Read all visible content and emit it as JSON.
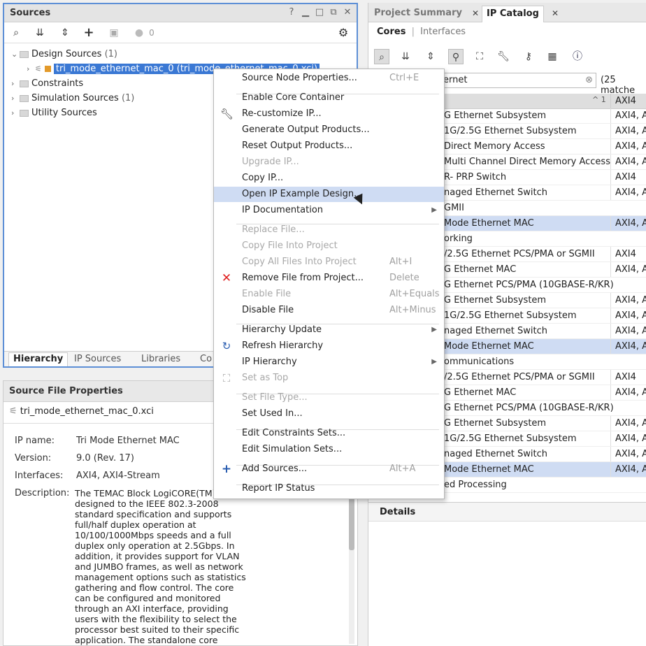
{
  "sources": {
    "title": "Sources",
    "badge_count": "0",
    "tree": [
      {
        "label": "Design Sources",
        "count": "(1)"
      },
      {
        "label": "tri_mode_ethernet_mac_0 (tri_mode_ethernet_mac_0.xci)"
      },
      {
        "label": "Constraints"
      },
      {
        "label": "Simulation Sources",
        "count": "(1)"
      },
      {
        "label": "Utility Sources"
      }
    ],
    "tabs": [
      "Hierarchy",
      "IP Sources",
      "Libraries",
      "Co"
    ]
  },
  "props": {
    "title": "Source File Properties",
    "filename": "tri_mode_ethernet_mac_0.xci",
    "ip_name_label": "IP name:",
    "ip_name": "Tri Mode Ethernet MAC",
    "version_label": "Version:",
    "version": "9.0 (Rev. 17)",
    "interfaces_label": "Interfaces:",
    "interfaces": "AXI4, AXI4-Stream",
    "description_label": "Description:",
    "description": "The TEMAC Block LogiCORE(TM)\ndesigned to the IEEE 802.3-2008\nstandard specification and supports\nfull/half duplex operation at\n10/100/1000Mbps speeds and a full\nduplex only operation at 2.5Gbps. In\naddition, it provides support for VLAN\nand JUMBO frames, as well as network\nmanagement options such as statistics\ngathering and flow control. The core\ncan be configured and monitored\nthrough an AXI interface, providing\nusers with the flexibility to select the\nprocessor best suited to their specific\napplication. The standalone core"
  },
  "right": {
    "tabs": [
      "Project Summary",
      "IP Catalog"
    ],
    "subtabs": [
      "Cores",
      "Interfaces"
    ],
    "search_value": "ernet",
    "matches": "(25 matche",
    "header_col2": "AXI4",
    "sort_marker": "^ 1",
    "rows": [
      {
        "name": "G Ethernet Subsystem",
        "iface": "AXI4, AX",
        "hl": false
      },
      {
        "name": "1G/2.5G Ethernet Subsystem",
        "iface": "AXI4, AX",
        "hl": false
      },
      {
        "name": "Direct Memory Access",
        "iface": "AXI4, AX",
        "hl": false
      },
      {
        "name": "Multi Channel Direct Memory Access",
        "iface": "AXI4, AX",
        "hl": false
      },
      {
        "name": "R- PRP Switch",
        "iface": "AXI4",
        "hl": false
      },
      {
        "name": "naged Ethernet Switch",
        "iface": "AXI4, AX",
        "hl": false
      },
      {
        "name": "GMII",
        "iface": "",
        "hl": false
      },
      {
        "name": "Mode Ethernet MAC",
        "iface": "AXI4, AX",
        "hl": true
      },
      {
        "name": "orking",
        "iface": "",
        "hl": false
      },
      {
        "name": "/2.5G Ethernet PCS/PMA or SGMII",
        "iface": "AXI4",
        "hl": false
      },
      {
        "name": "G Ethernet MAC",
        "iface": "AXI4, AX",
        "hl": false
      },
      {
        "name": "G Ethernet PCS/PMA (10GBASE-R/KR)",
        "iface": "",
        "hl": false
      },
      {
        "name": "G Ethernet Subsystem",
        "iface": "AXI4, AX",
        "hl": false
      },
      {
        "name": "1G/2.5G Ethernet Subsystem",
        "iface": "AXI4, AX",
        "hl": false
      },
      {
        "name": "naged Ethernet Switch",
        "iface": "AXI4, AX",
        "hl": false
      },
      {
        "name": "Mode Ethernet MAC",
        "iface": "AXI4, AX",
        "hl": true
      },
      {
        "name": "ommunications",
        "iface": "",
        "hl": false
      },
      {
        "name": "/2.5G Ethernet PCS/PMA or SGMII",
        "iface": "AXI4",
        "hl": false
      },
      {
        "name": "G Ethernet MAC",
        "iface": "AXI4, AX",
        "hl": false
      },
      {
        "name": "G Ethernet PCS/PMA (10GBASE-R/KR)",
        "iface": "",
        "hl": false
      },
      {
        "name": "G Ethernet Subsystem",
        "iface": "AXI4, AX",
        "hl": false
      },
      {
        "name": "1G/2.5G Ethernet Subsystem",
        "iface": "AXI4, AX",
        "hl": false
      },
      {
        "name": "naged Ethernet Switch",
        "iface": "AXI4, AX",
        "hl": false
      },
      {
        "name": "Mode Ethernet MAC",
        "iface": "AXI4, AX",
        "hl": true
      },
      {
        "name": "ed Processing",
        "iface": "",
        "hl": false
      }
    ],
    "details_title": "Details"
  },
  "menu": {
    "items": [
      {
        "label": "Source Node Properties...",
        "shortcut": "Ctrl+E",
        "disabled": false
      },
      {
        "label": "Enable Core Container",
        "shortcut": "",
        "disabled": false
      },
      {
        "label": "Re-customize IP...",
        "shortcut": "",
        "disabled": false,
        "icon": "wrench-icon"
      },
      {
        "label": "Generate Output Products...",
        "shortcut": "",
        "disabled": false
      },
      {
        "label": "Reset Output Products...",
        "shortcut": "",
        "disabled": false
      },
      {
        "label": "Upgrade IP...",
        "shortcut": "",
        "disabled": true
      },
      {
        "label": "Copy IP...",
        "shortcut": "",
        "disabled": false
      },
      {
        "label": "Open IP Example Design...",
        "shortcut": "",
        "disabled": false,
        "hover": true
      },
      {
        "label": "IP Documentation",
        "shortcut": "",
        "disabled": false,
        "submenu": true
      },
      {
        "label": "Replace File...",
        "shortcut": "",
        "disabled": true
      },
      {
        "label": "Copy File Into Project",
        "shortcut": "",
        "disabled": true
      },
      {
        "label": "Copy All Files Into Project",
        "shortcut": "Alt+I",
        "disabled": true
      },
      {
        "label": "Remove File from Project...",
        "shortcut": "Delete",
        "disabled": false,
        "icon": "remove-x-icon"
      },
      {
        "label": "Enable File",
        "shortcut": "Alt+Equals",
        "disabled": true
      },
      {
        "label": "Disable File",
        "shortcut": "Alt+Minus",
        "disabled": false
      },
      {
        "label": "Hierarchy Update",
        "shortcut": "",
        "disabled": false,
        "submenu": true
      },
      {
        "label": "Refresh Hierarchy",
        "shortcut": "",
        "disabled": false,
        "icon": "refresh-icon"
      },
      {
        "label": "IP Hierarchy",
        "shortcut": "",
        "disabled": false,
        "submenu": true
      },
      {
        "label": "Set as Top",
        "shortcut": "",
        "disabled": true,
        "icon": "hierarchy-icon"
      },
      {
        "label": "Set File Type...",
        "shortcut": "",
        "disabled": true
      },
      {
        "label": "Set Used In...",
        "shortcut": "",
        "disabled": false
      },
      {
        "label": "Edit Constraints Sets...",
        "shortcut": "",
        "disabled": false
      },
      {
        "label": "Edit Simulation Sets...",
        "shortcut": "",
        "disabled": false
      },
      {
        "label": "Add Sources...",
        "shortcut": "Alt+A",
        "disabled": false,
        "icon": "plus-icon"
      },
      {
        "label": "Report IP Status",
        "shortcut": "",
        "disabled": false
      }
    ]
  },
  "colors": {
    "accent": "#5d8fd6",
    "selection": "#3a78d4",
    "hover": "#cfdcf3",
    "remove": "#e02020",
    "add": "#2a5db0"
  }
}
